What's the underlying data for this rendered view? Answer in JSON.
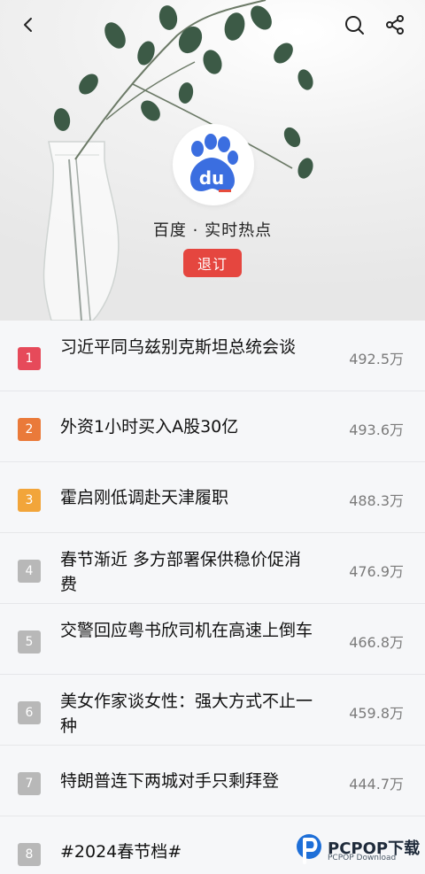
{
  "header": {
    "channel_title": "百度 · 实时热点",
    "unsubscribe_label": "退订",
    "logo_text": "du"
  },
  "items": [
    {
      "rank": "1",
      "title": "习近平同乌兹别克斯坦总统会谈",
      "count": "492.5万",
      "color": "#e64a5a"
    },
    {
      "rank": "2",
      "title": "外资1小时买入A股30亿",
      "count": "493.6万",
      "color": "#ea7a3a"
    },
    {
      "rank": "3",
      "title": "霍启刚低调赴天津履职",
      "count": "488.3万",
      "color": "#f2a53a"
    },
    {
      "rank": "4",
      "title": "春节渐近 多方部署保供稳价促消费",
      "count": "476.9万",
      "color": "#b8b8b8"
    },
    {
      "rank": "5",
      "title": "交警回应粤书欣司机在高速上倒车",
      "count": "466.8万",
      "color": "#b8b8b8"
    },
    {
      "rank": "6",
      "title": "美女作家谈女性：强大方式不止一种",
      "count": "459.8万",
      "color": "#b8b8b8"
    },
    {
      "rank": "7",
      "title": "特朗普连下两城对手只剩拜登",
      "count": "444.7万",
      "color": "#b8b8b8"
    },
    {
      "rank": "8",
      "title": "#2024春节档#",
      "count": "",
      "color": "#b8b8b8"
    }
  ],
  "watermark": {
    "brand": "PCPOP下载",
    "sub": "PCPOP Download"
  }
}
